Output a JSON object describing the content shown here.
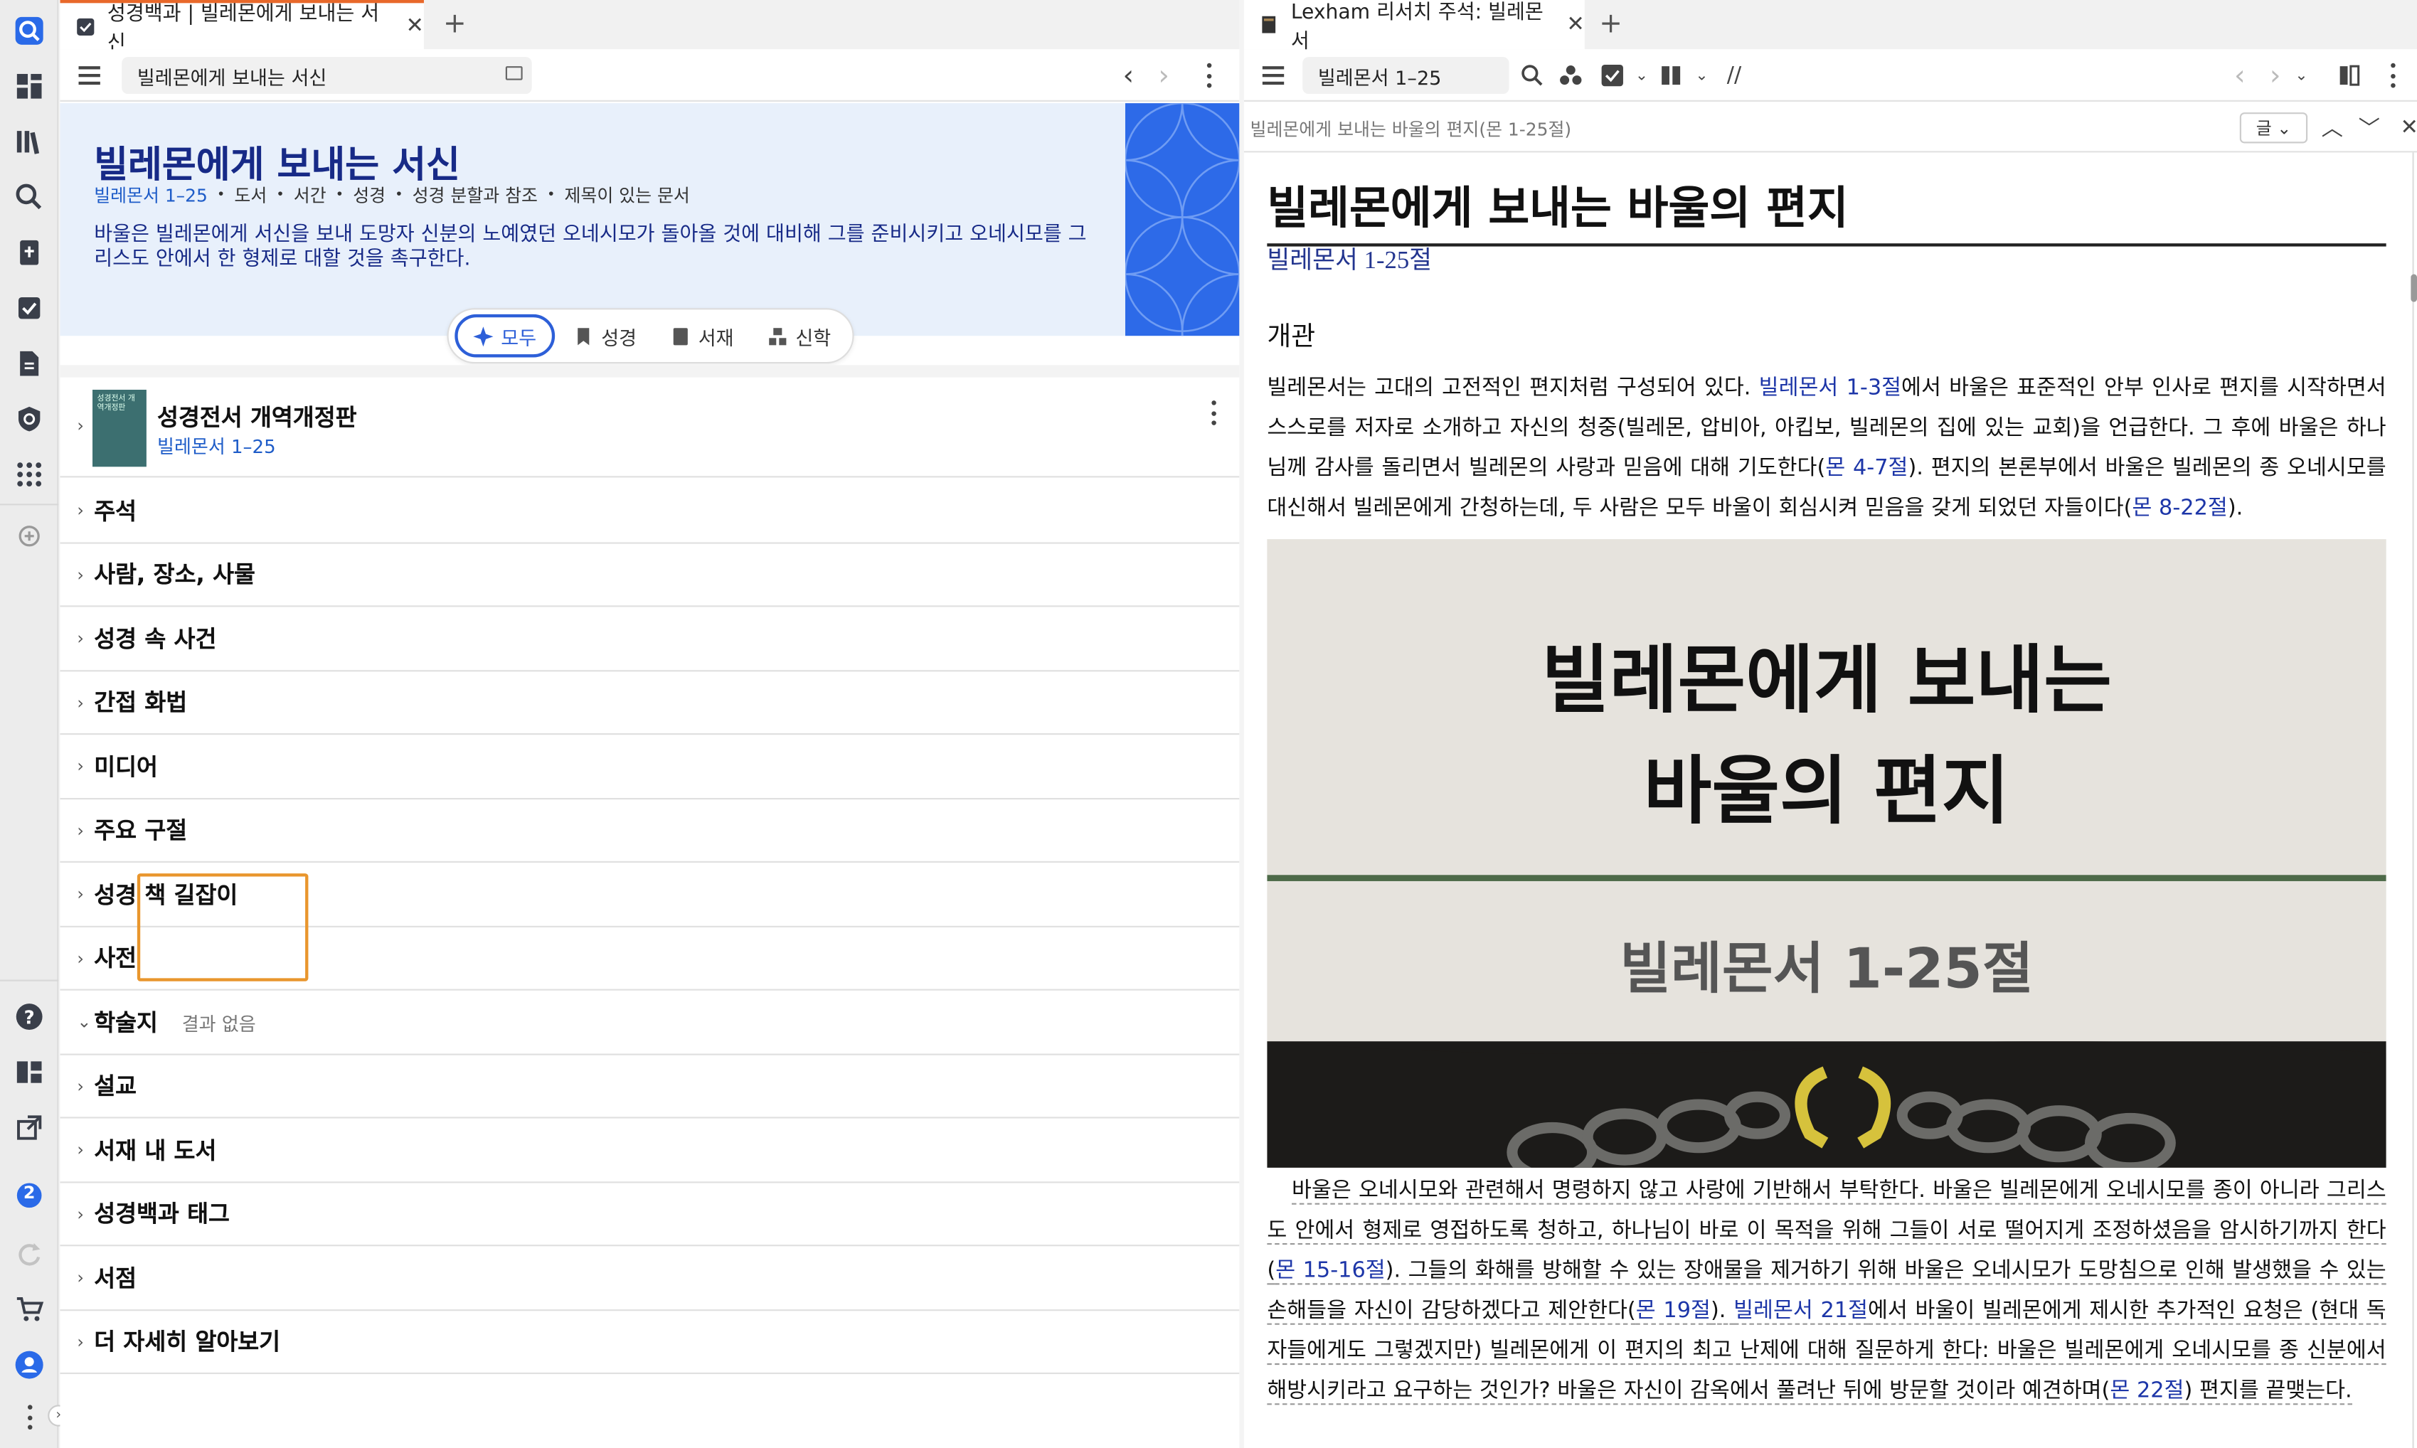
{
  "left_pane": {
    "tab_title": "성경백과 | 빌레몬에게 보내는 서신",
    "search_value": "빌레몬에게 보내는 서신",
    "header": {
      "title": "빌레몬에게 보내는 서신",
      "meta": [
        "빌레몬서 1–25",
        "도서",
        "서간",
        "성경",
        "성경 분할과 참조",
        "제목이 있는 문서"
      ],
      "description": "바울은 빌레몬에게 서신을 보내 도망자 신분의 노예였던 오네시모가 돌아올 것에 대비해 그를 준비시키고 오네시모를 그리스도 안에서 한 형제로 대할 것을 촉구한다."
    },
    "filters": [
      "모두",
      "성경",
      "서재",
      "신학"
    ],
    "book": {
      "title": "성경전서 개역개정판",
      "reference": "빌레몬서 1–25",
      "cover_text": "성경전서 개역개정판"
    },
    "sections": [
      {
        "label": "주석",
        "note": ""
      },
      {
        "label": "사람, 장소, 사물",
        "note": ""
      },
      {
        "label": "성경 속 사건",
        "note": ""
      },
      {
        "label": "간접 화법",
        "note": ""
      },
      {
        "label": "미디어",
        "note": ""
      },
      {
        "label": "주요 구절",
        "note": ""
      },
      {
        "label": "성경 책 길잡이",
        "note": ""
      },
      {
        "label": "사전",
        "note": ""
      },
      {
        "label": "학술지",
        "note": "결과 없음"
      },
      {
        "label": "설교",
        "note": ""
      },
      {
        "label": "서재 내 도서",
        "note": ""
      },
      {
        "label": "성경백과 태그",
        "note": ""
      },
      {
        "label": "서점",
        "note": ""
      },
      {
        "label": "더 자세히 알아보기",
        "note": ""
      }
    ]
  },
  "right_pane": {
    "tab_title": "Lexham 리서치 주석: 빌레몬서",
    "reference_box": "빌레몬서 1–25",
    "path": "빌레몬에게 보내는 바울의 편지(몬 1-25절)",
    "format_label": "글",
    "article": {
      "title": "빌레몬에게 보내는 바울의 편지",
      "reference": "빌레몬서 1-25절",
      "heading": "개관",
      "p1": [
        {
          "t": "빌레몬서는 고대의 고전적인 편지처럼 구성되어 있다. ",
          "link": false
        },
        {
          "t": "빌레몬서 1-3절",
          "link": true
        },
        {
          "t": "에서 바울은 표준적인 안부 인사로 편지를 시작하면서 스스로를 저자로 소개하고 자신의 청중(빌레몬, 압비아, 아킵보, 빌레몬의 집에 있는 교회)을 언급한다. 그 후에 바울은 하나님께 감사를 돌리면서 빌레몬의 사랑과 믿음에 대해 기도한다(",
          "link": false
        },
        {
          "t": "몬 4-7절",
          "link": true
        },
        {
          "t": "). 편지의 본론부에서 바울은 빌레몬의 종 오네시모를 대신해서 빌레몬에게 간청하는데, 두 사람은 모두 바울이 회심시켜 믿음을 갖게 되었던 자들이다(",
          "link": false
        },
        {
          "t": "몬 8-22절",
          "link": true
        },
        {
          "t": ").",
          "link": false
        }
      ],
      "image": {
        "title_line1": "빌레몬에게 보내는",
        "title_line2": "바울의 편지",
        "subtitle": "빌레몬서 1-25절"
      },
      "p2": [
        {
          "t": "바울은 오네시모와 관련해서 명령하지 않고 사랑에 기반해서 부탁한다. 바울은 빌레몬에게 오네시모를 종이 아니라 그리스도 안에서 형제로 영접하도록 청하고, 하나님이 바로 이 목적을 위해 그들이 서로 떨어지게 조정하셨음을 암시하기까지 한다(",
          "link": false
        },
        {
          "t": "몬 15-16절",
          "link": true
        },
        {
          "t": "). 그들의 화해를 방해할 수 있는 장애물을 제거하기 위해 바울은 오네시모가 도망침으로 인해 발생했을 수 있는 손해들을 자신이 감당하겠다고 제안한다(",
          "link": false
        },
        {
          "t": "몬 19절",
          "link": true
        },
        {
          "t": "). ",
          "link": false
        },
        {
          "t": "빌레몬서 21절",
          "link": true
        },
        {
          "t": "에서 바울이 빌레몬에게 제시한 추가적인 요청은 (현대 독자들에게도 그렇겠지만) 빌레몬에게 이 편지의 최고 난제에 대해 질문하게 한다: 바울은 빌레몬에게 오네시모를 종 신분에서 해방시키라고 요구하는 것인가? 바울은 자신이 감옥에서 풀려난 뒤에 방문할 것이라 예견하며(",
          "link": false
        },
        {
          "t": "몬 22절",
          "link": true
        },
        {
          "t": ") 편지를 끝맺는다.",
          "link": false
        }
      ]
    }
  },
  "sidebar": {
    "badge_count": "2"
  },
  "colors": {
    "accent": "#2d5fd8",
    "header_band": "#e8f0fb",
    "title_navy": "#172a87",
    "highlight": "#e9962d"
  }
}
